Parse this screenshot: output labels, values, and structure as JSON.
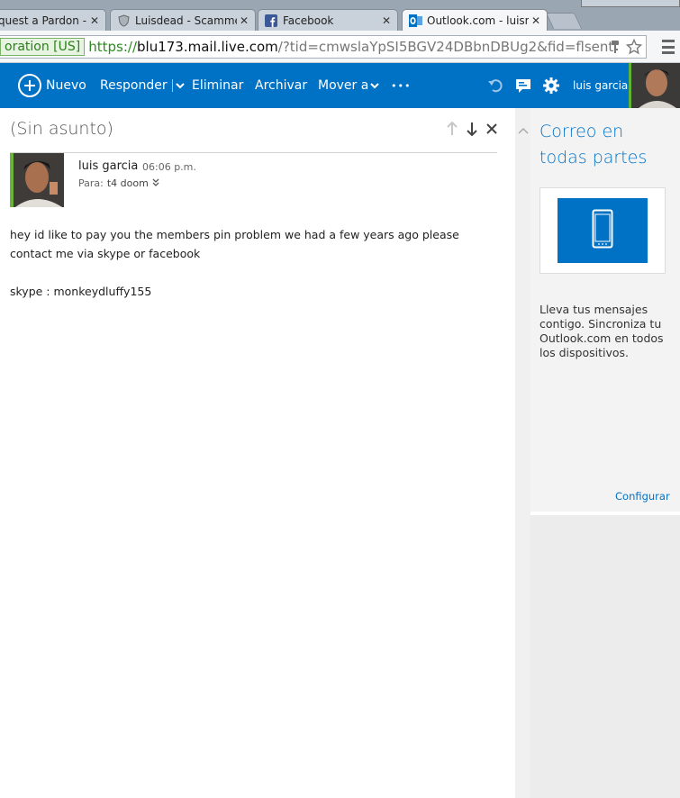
{
  "browser": {
    "tabs": [
      {
        "label": "quest a Pardon - S",
        "icon": "page-icon"
      },
      {
        "label": "Luisdead - Scamme",
        "icon": "shield-icon"
      },
      {
        "label": "Facebook",
        "icon": "facebook-icon"
      },
      {
        "label": "Outlook.com - luism",
        "icon": "outlook-icon",
        "active": true
      }
    ],
    "ev_badge": "oration [US]",
    "url_scheme": "https://",
    "url_host": "blu173.mail.live.com",
    "url_rest": "/?tid=cmwslaYpSI5BGV24DBbnDBUg2&fid=flsent"
  },
  "toolbar": {
    "new_label": "Nuevo",
    "reply_label": "Responder",
    "delete_label": "Eliminar",
    "archive_label": "Archivar",
    "move_label": "Mover a",
    "more_label": "•••",
    "user_name": "luis garcia"
  },
  "message": {
    "subject": "(Sin asunto)",
    "sender_name": "luis garcia",
    "time": "06:06 p.m.",
    "to_prefix": "Para:",
    "to_name": "t4 doom",
    "body": [
      "hey id like to pay you the members pin problem we had a few years ago please contact me via skype or facebook",
      "skype : monkeydluffy155"
    ]
  },
  "promo": {
    "title": "Correo en todas partes",
    "text": "Lleva tus mensajes contigo. Sincroniza tu Outlook.com en todos los dispositivos.",
    "link": "Configurar"
  },
  "colors": {
    "brand_blue": "#0072c6",
    "ev_green": "#2b8b1f",
    "avatar_accent": "#6cb33e"
  }
}
